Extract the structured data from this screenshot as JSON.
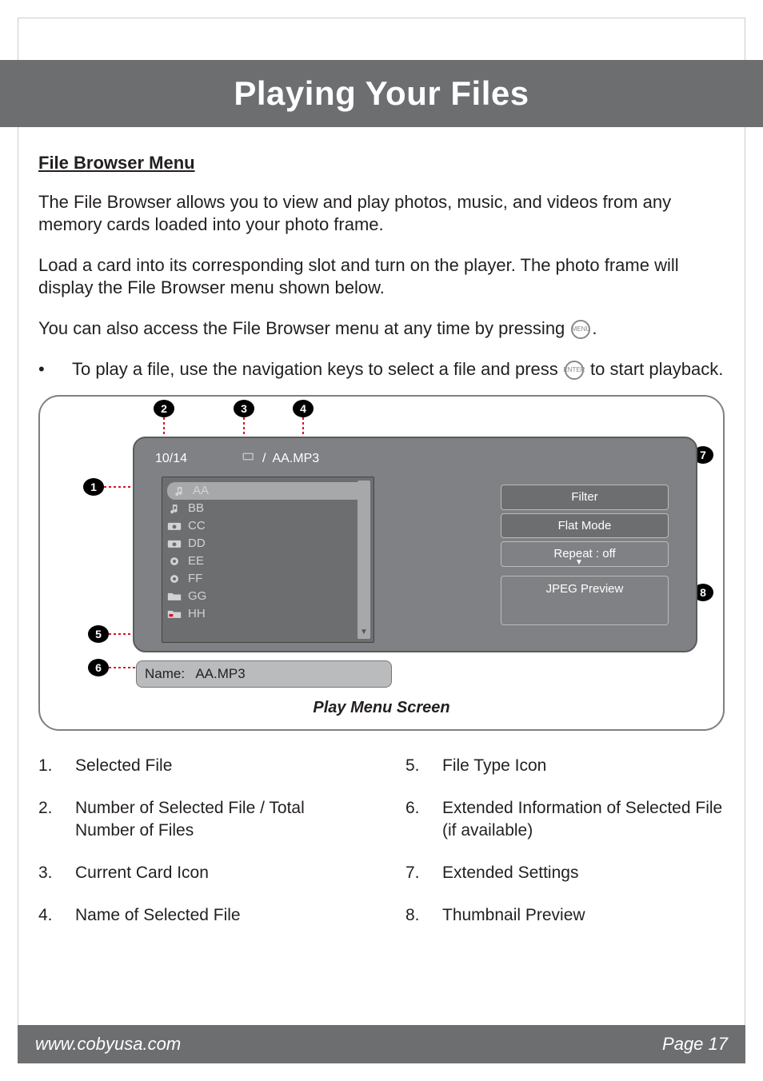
{
  "header": {
    "title": "Playing Your Files"
  },
  "section": {
    "title": "File Browser Menu",
    "p1": "The File Browser allows you to view and play photos, music, and videos from any memory cards loaded into your photo frame.",
    "p2": "Load a card into its corresponding slot and turn on the player. The photo frame will display the File Browser menu shown below.",
    "p3_pre": "You can also access the File Browser menu at any time by pressing ",
    "p3_btn": "MENU",
    "p3_post": ".",
    "bullet_pre": "To play a file, use the navigation keys to select a file and press ",
    "bullet_btn": "ENTER",
    "bullet_post": " to start playback."
  },
  "diagram": {
    "counter": "10/14",
    "path_sep": "/",
    "current_name": "AA.MP3",
    "files": [
      {
        "icon": "music-icon",
        "label": "AA",
        "selected": true
      },
      {
        "icon": "music-icon",
        "label": "BB"
      },
      {
        "icon": "camera-icon",
        "label": "CC"
      },
      {
        "icon": "camera-icon",
        "label": "DD"
      },
      {
        "icon": "gear-icon",
        "label": "EE"
      },
      {
        "icon": "gear-icon",
        "label": "FF"
      },
      {
        "icon": "folder-icon",
        "label": "GG"
      },
      {
        "icon": "folder-icon",
        "label": "HH"
      }
    ],
    "settings": {
      "filter": "Filter",
      "flat": "Flat Mode",
      "repeat": "Repeat   : off"
    },
    "preview": "JPEG Preview",
    "name_label": "Name:",
    "name_value": "AA.MP3",
    "caption": "Play Menu Screen"
  },
  "legend": [
    {
      "n": "1.",
      "t": "Selected File"
    },
    {
      "n": "2.",
      "t": "Number of Selected File / Total Number of Files"
    },
    {
      "n": "3.",
      "t": "Current Card Icon"
    },
    {
      "n": "4.",
      "t": "Name of Selected File"
    },
    {
      "n": "5.",
      "t": "File Type Icon"
    },
    {
      "n": "6.",
      "t": "Extended Information of Selected File (if available)"
    },
    {
      "n": "7.",
      "t": "Extended Settings"
    },
    {
      "n": "8.",
      "t": "Thumbnail Preview"
    }
  ],
  "footer": {
    "url": "www.cobyusa.com",
    "page": "Page 17"
  },
  "callouts": {
    "1": "1",
    "2": "2",
    "3": "3",
    "4": "4",
    "5": "5",
    "6": "6",
    "7": "7",
    "8": "8"
  }
}
